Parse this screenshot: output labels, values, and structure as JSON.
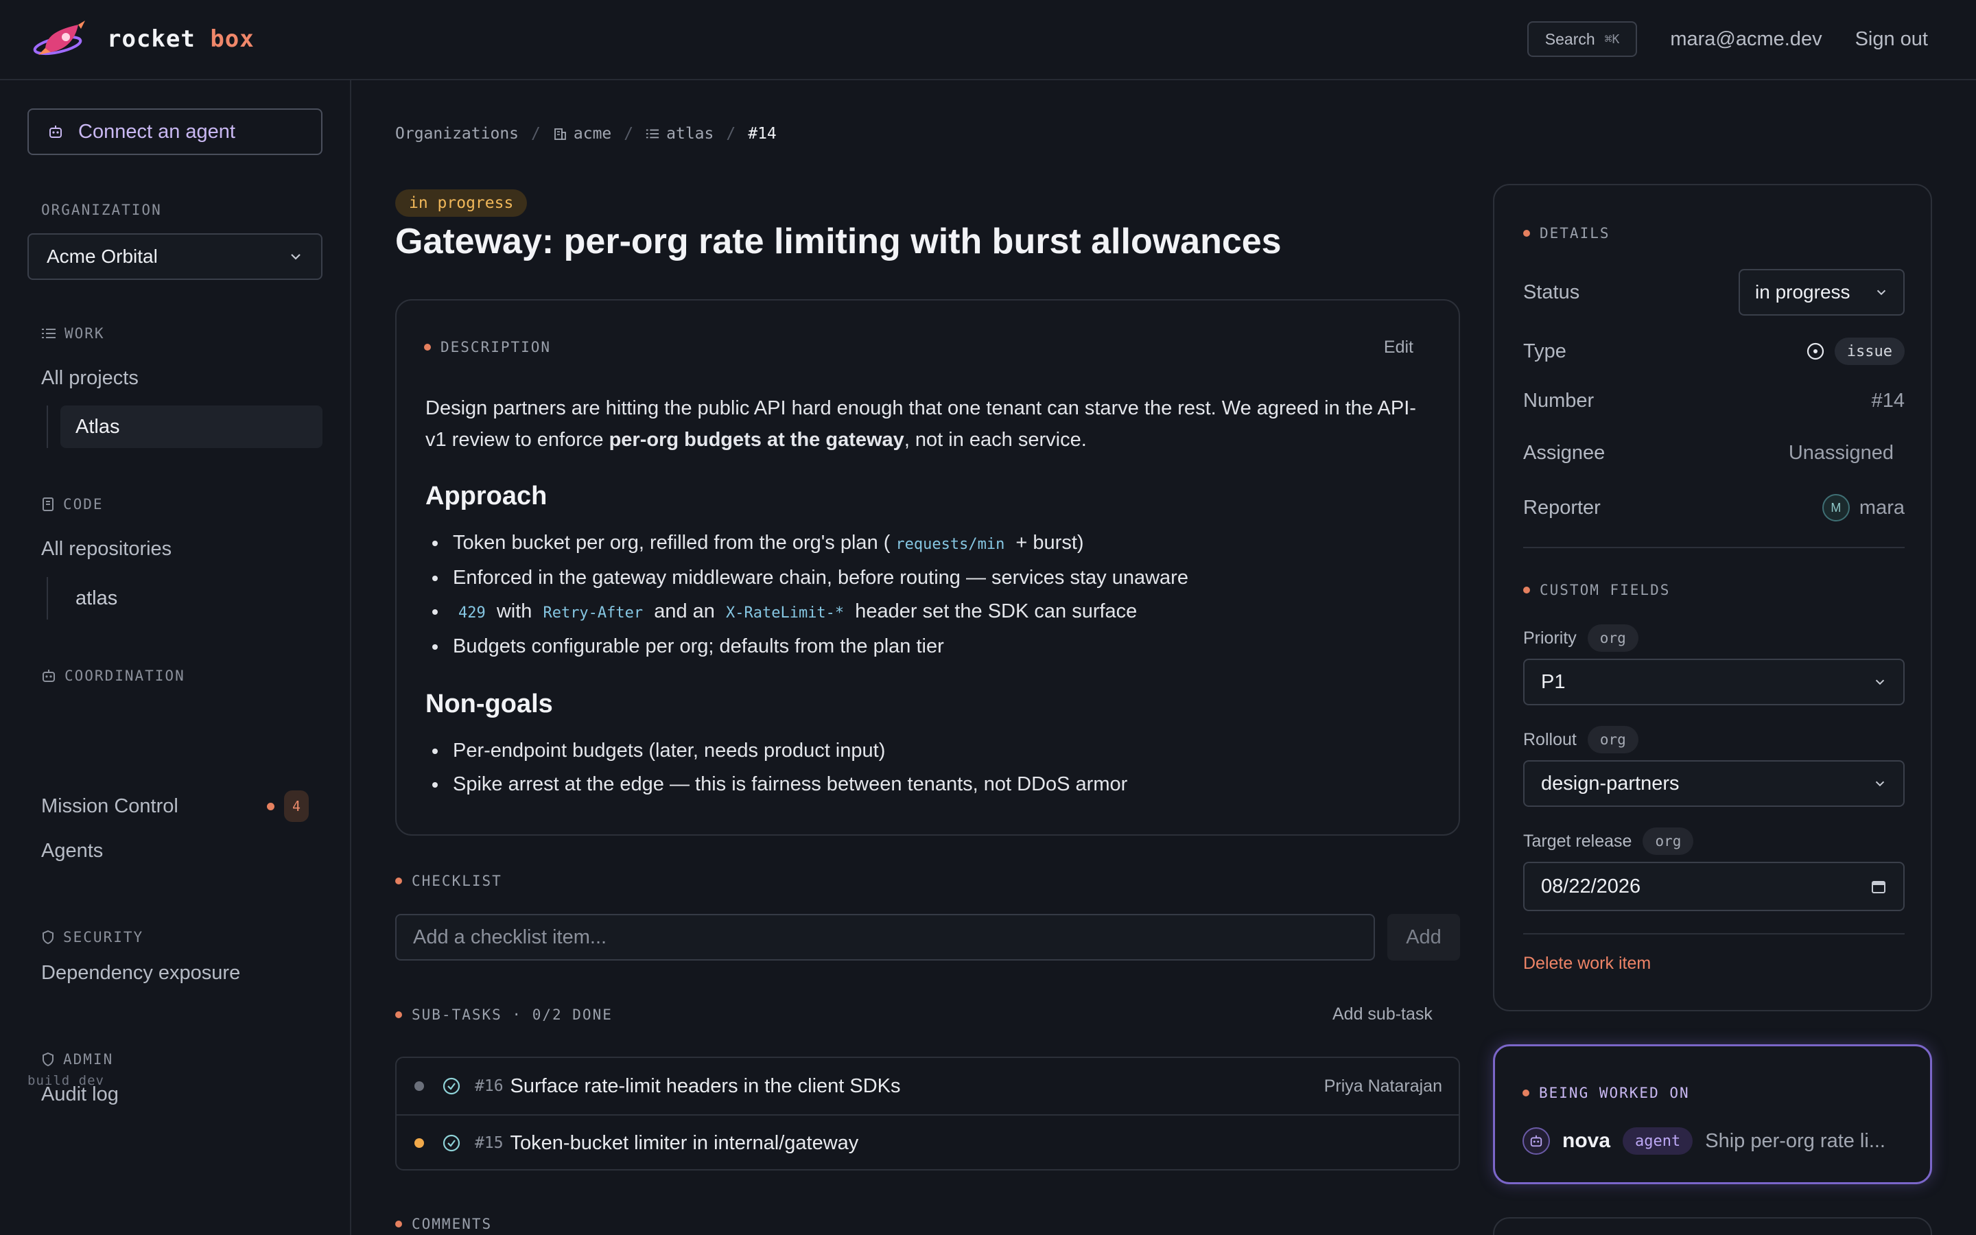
{
  "brand": {
    "name_part1": "rocket",
    "name_part2": "box"
  },
  "topbar": {
    "search_label": "Search",
    "search_shortcut": "⌘K",
    "user_email": "mara@acme.dev",
    "sign_out": "Sign out"
  },
  "sidebar": {
    "connect_agent": "Connect an agent",
    "organization_label": "ORGANIZATION",
    "organization_value": "Acme Orbital",
    "work_label": "WORK",
    "all_projects": "All projects",
    "project_atlas": "Atlas",
    "code_label": "CODE",
    "all_repositories": "All repositories",
    "repo_atlas": "atlas",
    "coordination_label": "COORDINATION",
    "mission_control": "Mission Control",
    "mission_control_count": "4",
    "agents": "Agents",
    "security_label": "SECURITY",
    "dependency_exposure": "Dependency exposure",
    "admin_label": "ADMIN",
    "audit_log": "Audit log",
    "build": "build dev"
  },
  "breadcrumb": {
    "organizations": "Organizations",
    "org": "acme",
    "project": "atlas",
    "current": "#14"
  },
  "issue": {
    "status_pill": "in progress",
    "title": "Gateway: per-org rate limiting with burst allowances"
  },
  "description": {
    "label": "DESCRIPTION",
    "edit": "Edit",
    "intro_pre": "Design partners are hitting the public API hard enough that one tenant can starve the rest. We agreed in the API-v1 review to enforce ",
    "intro_bold": "per-org budgets at the gateway",
    "intro_post": ", not in each service.",
    "approach_heading": "Approach",
    "approach_1_pre": "Token bucket per org, refilled from the org's plan (",
    "approach_1_code": "requests/min",
    "approach_1_post": "+ burst)",
    "approach_2": "Enforced in the gateway middleware chain, before routing — services stay unaware",
    "approach_3_code1": "429",
    "approach_3_mid1": "with",
    "approach_3_code2": "Retry-After",
    "approach_3_mid2": "and an",
    "approach_3_code3": "X-RateLimit-*",
    "approach_3_post": "header set the SDK can surface",
    "approach_4": "Budgets configurable per org; defaults from the plan tier",
    "nongoals_heading": "Non-goals",
    "nongoal_1": "Per-endpoint budgets (later, needs product input)",
    "nongoal_2": "Spike arrest at the edge — this is fairness between tenants, not DDoS armor"
  },
  "checklist": {
    "label": "CHECKLIST",
    "placeholder": "Add a checklist item...",
    "add": "Add"
  },
  "subtasks": {
    "label": "SUB-TASKS · 0/2 DONE",
    "add": "Add sub-task",
    "items": [
      {
        "num": "#16",
        "title": "Surface rate-limit headers in the client SDKs",
        "assignee": "Priya Natarajan",
        "dot_color": "#6b707b"
      },
      {
        "num": "#15",
        "title": "Token-bucket limiter in internal/gateway",
        "assignee": "",
        "dot_color": "#f1a94a"
      }
    ]
  },
  "comments": {
    "label": "COMMENTS"
  },
  "details": {
    "label": "DETAILS",
    "status_key": "Status",
    "status_value": "in progress",
    "type_key": "Type",
    "type_value": "issue",
    "number_key": "Number",
    "number_value": "#14",
    "assignee_key": "Assignee",
    "assignee_value": "Unassigned",
    "reporter_key": "Reporter",
    "reporter_initial": "M",
    "reporter_value": "mara"
  },
  "custom_fields": {
    "label": "CUSTOM FIELDS",
    "org_tag": "org",
    "priority_label": "Priority",
    "priority_value": "P1",
    "rollout_label": "Rollout",
    "rollout_value": "design-partners",
    "target_label": "Target release",
    "target_value": "08/22/2026",
    "delete": "Delete work item"
  },
  "being_worked_on": {
    "label": "BEING WORKED ON",
    "agent_name": "nova",
    "agent_tag": "agent",
    "task": "Ship per-org rate li..."
  },
  "colors": {
    "accent": "#f0876a",
    "status_in_progress": "#f1b85a",
    "agent_purple": "#7b66c9",
    "mission_dot": "#e5805f"
  }
}
